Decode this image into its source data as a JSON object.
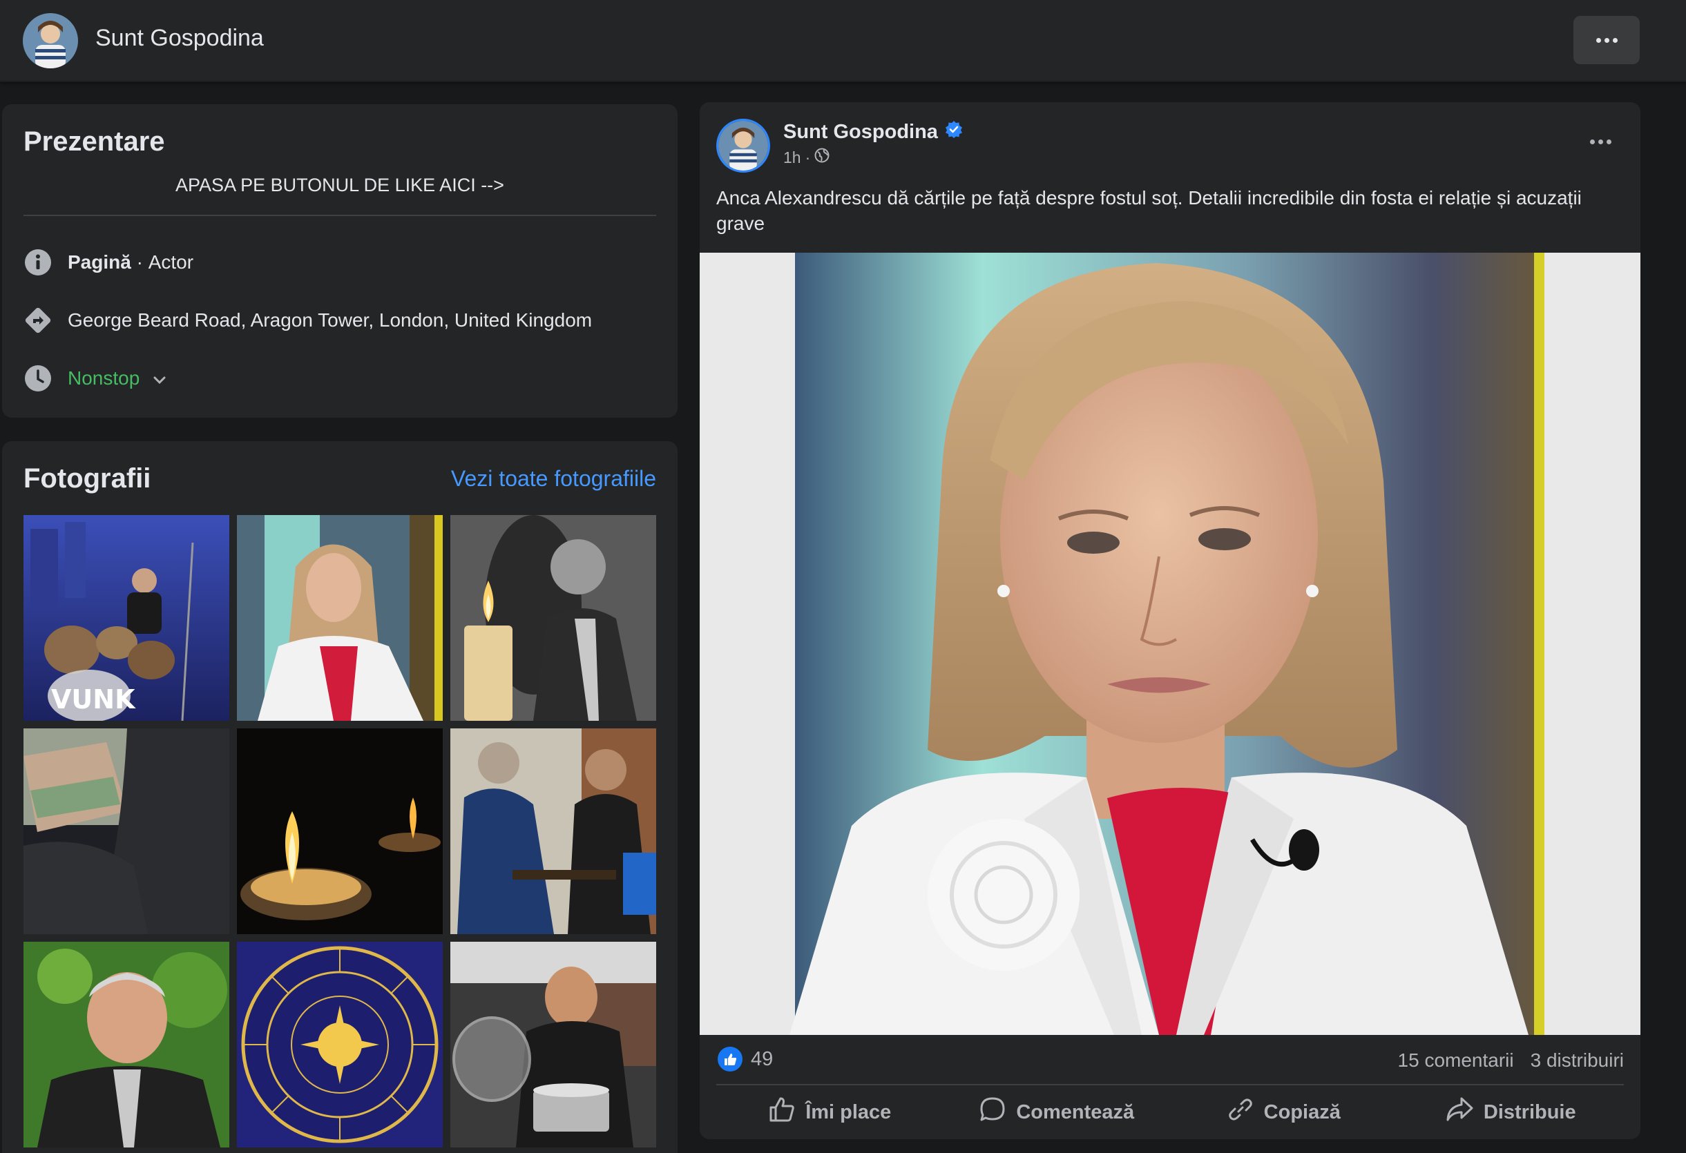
{
  "topbar": {
    "page_name": "Sunt Gospodina"
  },
  "intro": {
    "title": "Prezentare",
    "bio": "APASA PE BUTONUL DE LIKE AICI -->",
    "category_label": "Pagină",
    "category_sep": " · ",
    "category_value": "Actor",
    "address": "George Beard Road, Aragon Tower, London, United Kingdom",
    "hours": "Nonstop"
  },
  "photos": {
    "title": "Fotografii",
    "see_all": "Vezi toate fotografiile",
    "tile_watermark": "VUNK"
  },
  "post": {
    "author": "Sunt Gospodina",
    "time": "1h",
    "meta_sep": "·",
    "text": "Anca Alexandrescu dă cărțile pe față despre fostul soț. Detalii incredibile din fosta ei relație și acuzații grave",
    "reaction_count": "49",
    "comments": "15 comentarii",
    "shares": "3 distribuiri",
    "actions": {
      "like": "Îmi place",
      "comment": "Comentează",
      "copy": "Copiază",
      "share": "Distribuie"
    }
  },
  "colors": {
    "background": "#18191a",
    "card": "#242526",
    "accent": "#2d88ff",
    "link": "#4599ff",
    "open_status": "#45bd62"
  }
}
